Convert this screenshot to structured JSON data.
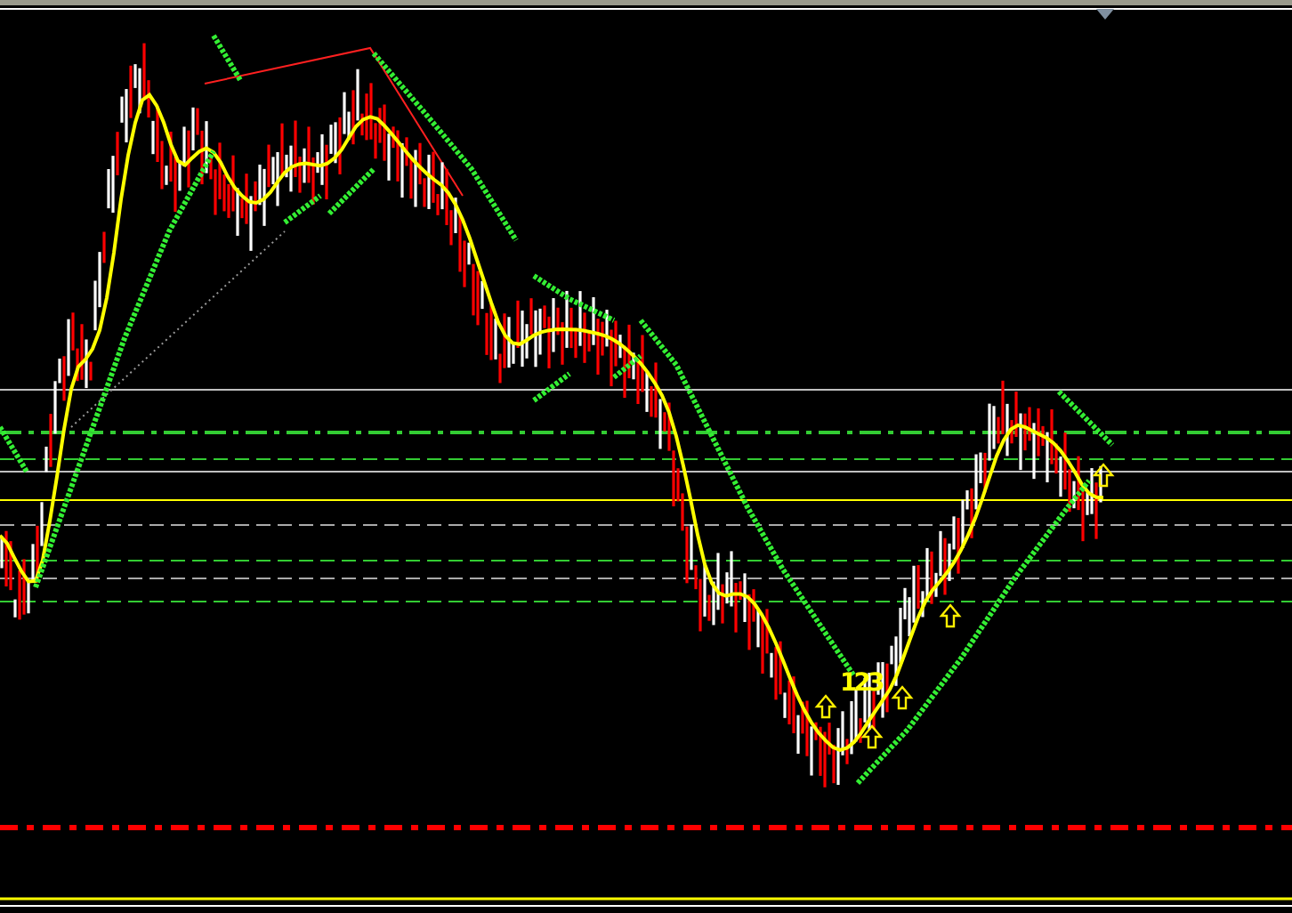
{
  "chart": {
    "pattern_label": "123"
  }
}
